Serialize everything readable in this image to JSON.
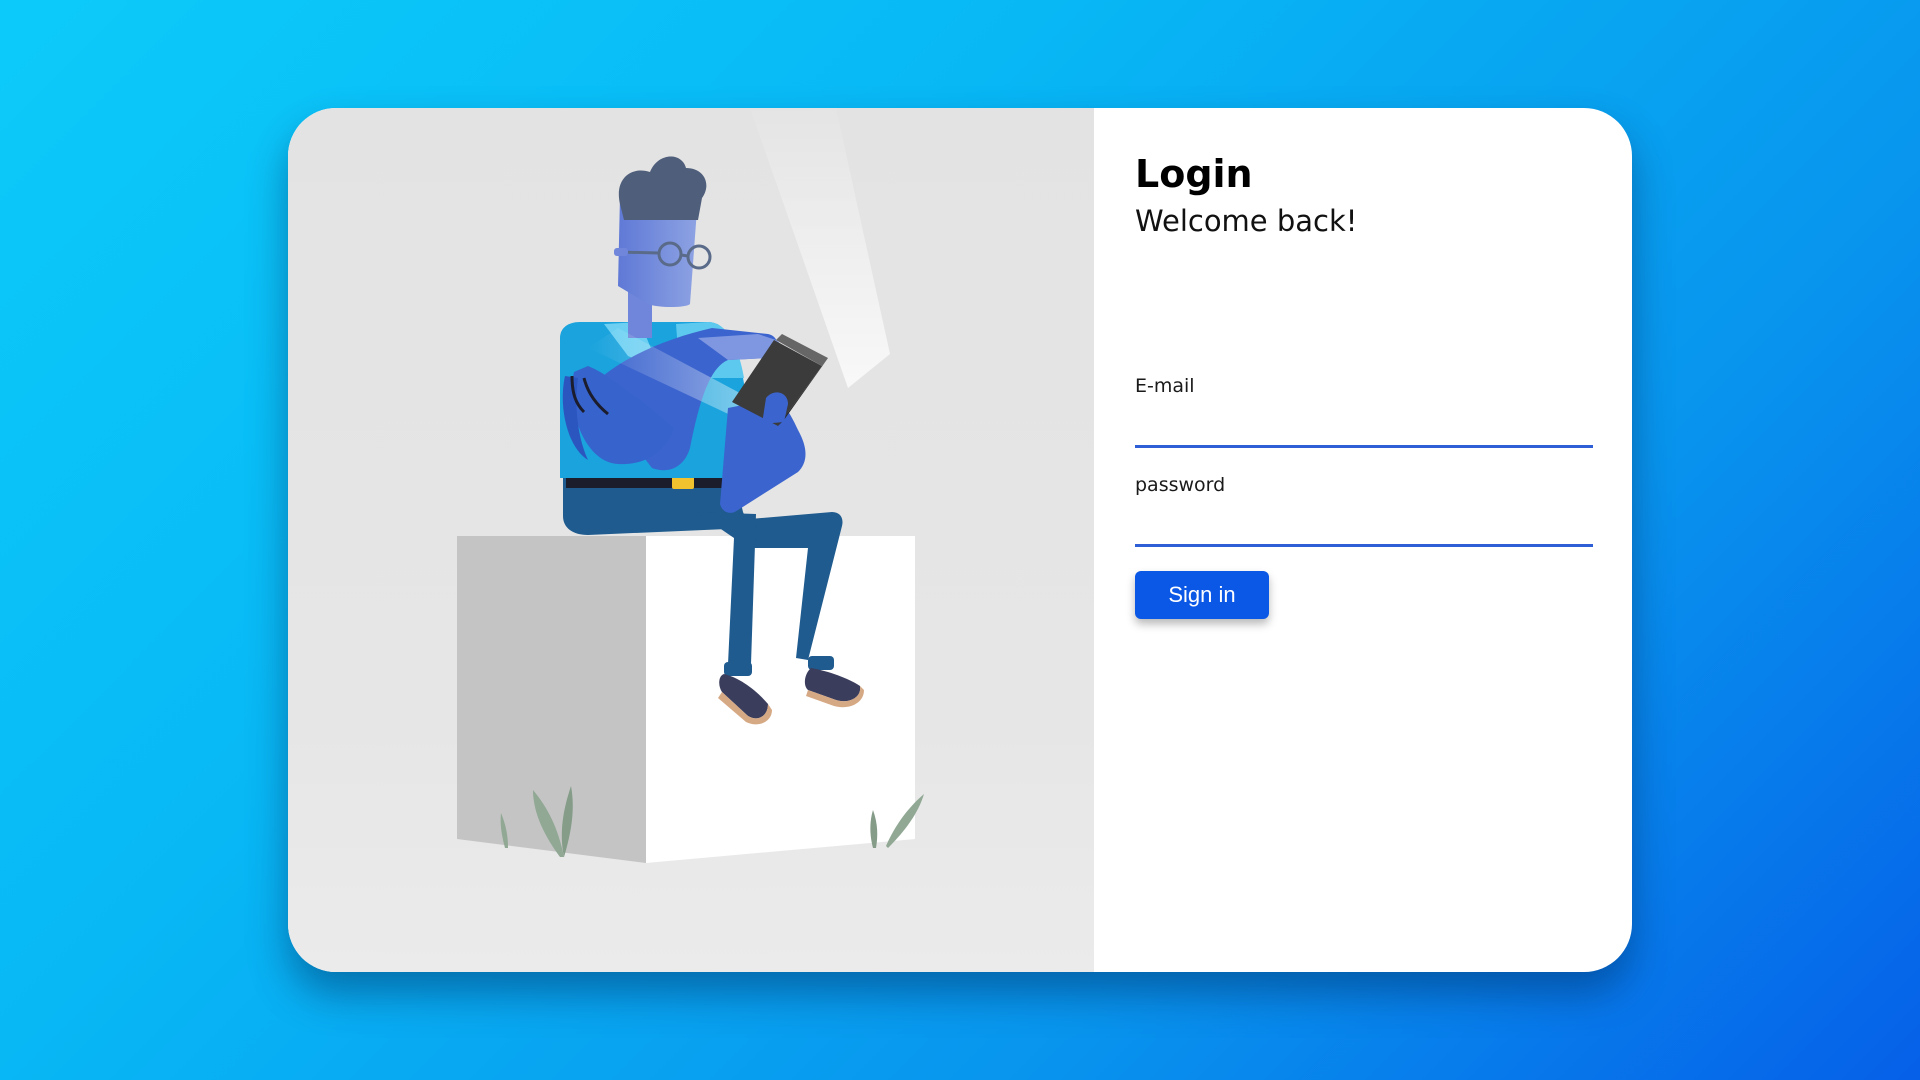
{
  "login": {
    "title": "Login",
    "subtitle": "Welcome back!",
    "email_label": "E-mail",
    "email_value": "",
    "password_label": "password",
    "password_value": "",
    "submit_label": "Sign in"
  },
  "colors": {
    "background_start": "#0ccbfa",
    "background_end": "#0660e8",
    "accent": "#0b57e6",
    "input_underline": "#2f5fd6"
  },
  "illustration": {
    "icon": "person-reading-tablet-illustration"
  }
}
